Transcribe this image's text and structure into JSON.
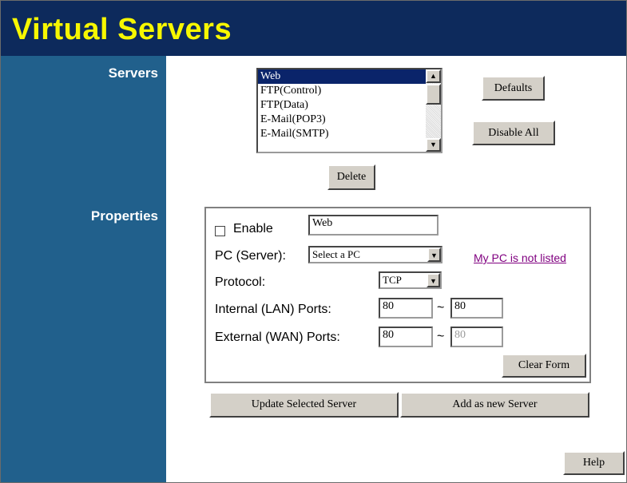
{
  "header": {
    "title": "Virtual Servers"
  },
  "sidebar": {
    "servers_label": "Servers",
    "properties_label": "Properties"
  },
  "servers": {
    "list": [
      "Web",
      "FTP(Control)",
      "FTP(Data)",
      "E-Mail(POP3)",
      "E-Mail(SMTP)"
    ],
    "selected": "Web",
    "defaults_button": "Defaults",
    "disable_all_button": "Disable All",
    "delete_button": "Delete"
  },
  "properties": {
    "enable_label": "Enable",
    "enable_checked": false,
    "name_value": "Web",
    "pc_label": "PC (Server):",
    "pc_select_value": "Select a PC",
    "pc_not_listed_link": "My PC is not listed",
    "protocol_label": "Protocol:",
    "protocol_value": "TCP",
    "internal_label": "Internal (LAN) Ports:",
    "internal_from": "80",
    "internal_to": "80",
    "external_label": "External (WAN) Ports:",
    "external_from": "80",
    "external_to": "80",
    "tilde": "~",
    "clear_form_button": "Clear Form"
  },
  "actions": {
    "update_button": "Update Selected Server",
    "add_button": "Add as new Server",
    "help_button": "Help"
  },
  "colors": {
    "header_bg": "#0d2a5c",
    "title": "#f7f700",
    "sidebar_bg": "#21608c",
    "link": "#800080",
    "selection": "#0a246a"
  }
}
